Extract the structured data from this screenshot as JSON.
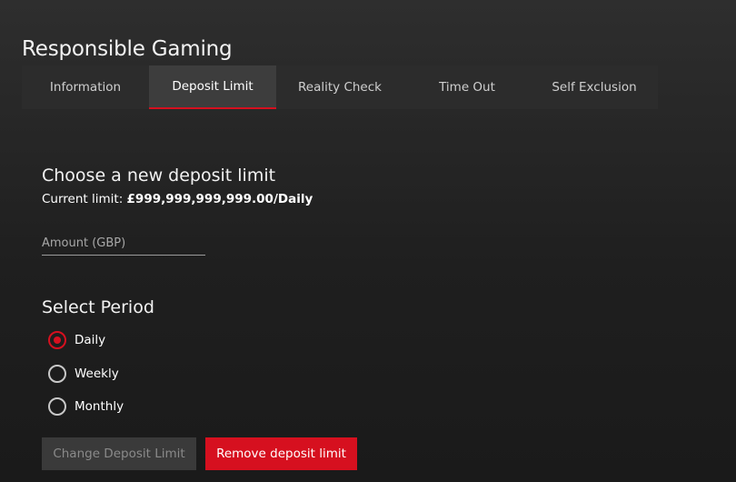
{
  "page": {
    "title": "Responsible Gaming"
  },
  "tabs": [
    {
      "label": "Information",
      "active": false
    },
    {
      "label": "Deposit Limit",
      "active": true
    },
    {
      "label": "Reality Check",
      "active": false
    },
    {
      "label": "Time Out",
      "active": false
    },
    {
      "label": "Self Exclusion",
      "active": false
    }
  ],
  "deposit": {
    "heading": "Choose a new deposit limit",
    "current_label": "Current limit: ",
    "current_value": "£999,999,999,999.00/Daily",
    "amount_placeholder": "Amount (GBP)",
    "amount_value": ""
  },
  "period": {
    "heading": "Select Period",
    "options": [
      {
        "label": "Daily",
        "checked": true
      },
      {
        "label": "Weekly",
        "checked": false
      },
      {
        "label": "Monthly",
        "checked": false
      }
    ]
  },
  "buttons": {
    "change_label": "Change Deposit Limit",
    "change_enabled": false,
    "remove_label": "Remove deposit limit"
  },
  "colors": {
    "accent": "#d6101f",
    "tab_bar": "#2c2c2c",
    "tab_active": "#3d3d3d",
    "disabled_button": "#3a3a3a"
  }
}
